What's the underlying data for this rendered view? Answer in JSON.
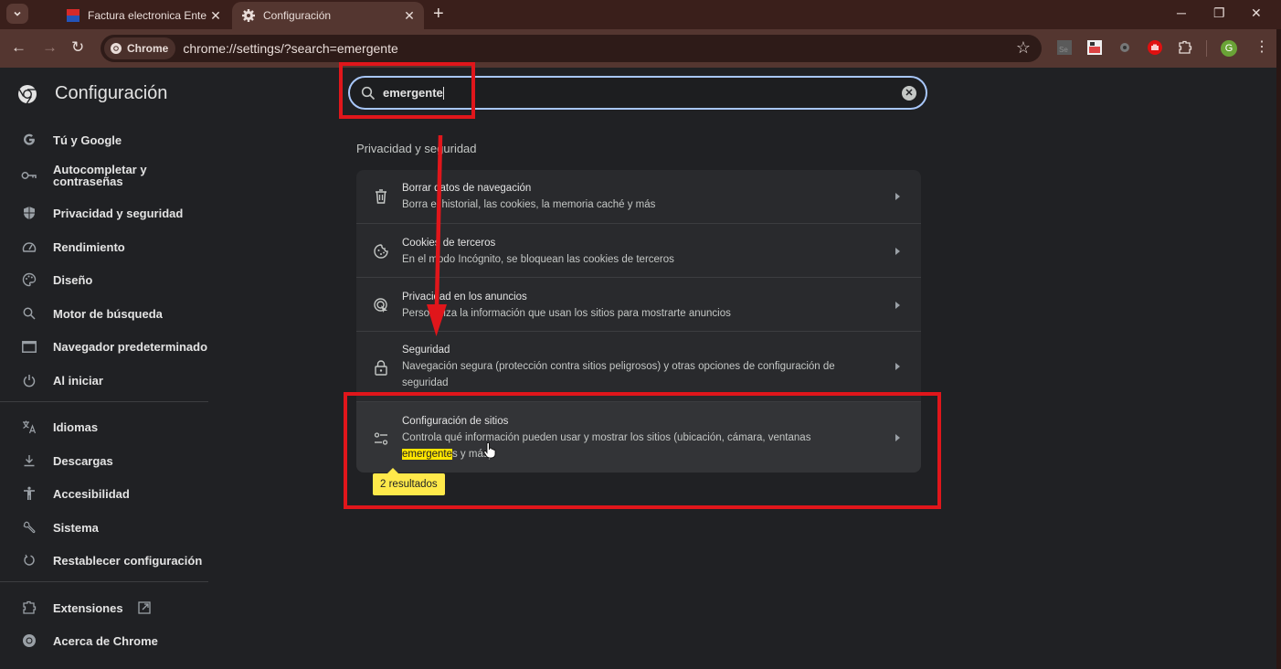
{
  "browser": {
    "tabs": [
      {
        "title": "Factura electronica Enternet - Fl",
        "active": false,
        "favicon": "enternet-favicon"
      },
      {
        "title": "Configuración",
        "active": true,
        "favicon": "gear-icon"
      }
    ],
    "omnibox": {
      "chip_label": "Chrome",
      "url": "chrome://settings/?search=emergente"
    },
    "extensions": [
      "selenium-ide-extension",
      "window-resizer-extension",
      "robot-extension",
      "adblock-extension"
    ],
    "avatar_letter": "G",
    "accent_color": "#a8c7fa"
  },
  "settings": {
    "title": "Configuración",
    "sidebar": {
      "items": [
        {
          "label": "Tú y Google",
          "icon": "google-g-icon"
        },
        {
          "label": "Autocompletar y contraseñas",
          "icon": "key-icon"
        },
        {
          "label": "Privacidad y seguridad",
          "icon": "shield-icon"
        },
        {
          "label": "Rendimiento",
          "icon": "speedometer-icon"
        },
        {
          "label": "Diseño",
          "icon": "palette-icon"
        },
        {
          "label": "Motor de búsqueda",
          "icon": "search-icon"
        },
        {
          "label": "Navegador predeterminado",
          "icon": "browser-window-icon"
        },
        {
          "label": "Al iniciar",
          "icon": "power-icon"
        },
        {
          "label": "Idiomas",
          "icon": "translate-icon"
        },
        {
          "label": "Descargas",
          "icon": "download-icon"
        },
        {
          "label": "Accesibilidad",
          "icon": "accessibility-icon"
        },
        {
          "label": "Sistema",
          "icon": "wrench-icon"
        },
        {
          "label": "Restablecer configuración",
          "icon": "reset-icon"
        },
        {
          "label": "Extensiones",
          "icon": "puzzle-icon",
          "external": true
        },
        {
          "label": "Acerca de Chrome",
          "icon": "chrome-icon"
        }
      ]
    },
    "search": {
      "value": "emergente"
    },
    "section_title": "Privacidad y seguridad",
    "rows": [
      {
        "title": "Borrar datos de navegación",
        "subtitle": "Borra el historial, las cookies, la memoria caché y más",
        "icon": "trash-icon"
      },
      {
        "title": "Cookies de terceros",
        "subtitle": "En el modo Incógnito, se bloquean las cookies de terceros",
        "icon": "cookie-icon"
      },
      {
        "title": "Privacidad en los anuncios",
        "subtitle": "Personaliza la información que usan los sitios para mostrarte anuncios",
        "icon": "ad-privacy-icon"
      },
      {
        "title": "Seguridad",
        "subtitle": "Navegación segura (protección contra sitios peligrosos) y otras opciones de configuración de seguridad",
        "icon": "lock-icon"
      },
      {
        "title": "Configuración de sitios",
        "subtitle_before": "Controla qué información pueden usar y mostrar los sitios (ubicación, cámara, ventanas ",
        "subtitle_highlight": "emergente",
        "subtitle_after": "s y más)",
        "icon": "tune-icon"
      }
    ],
    "results_bubble": "2 resultados",
    "highlight_color": "#ffe500"
  },
  "annotations": {
    "color": "#e0161b"
  }
}
